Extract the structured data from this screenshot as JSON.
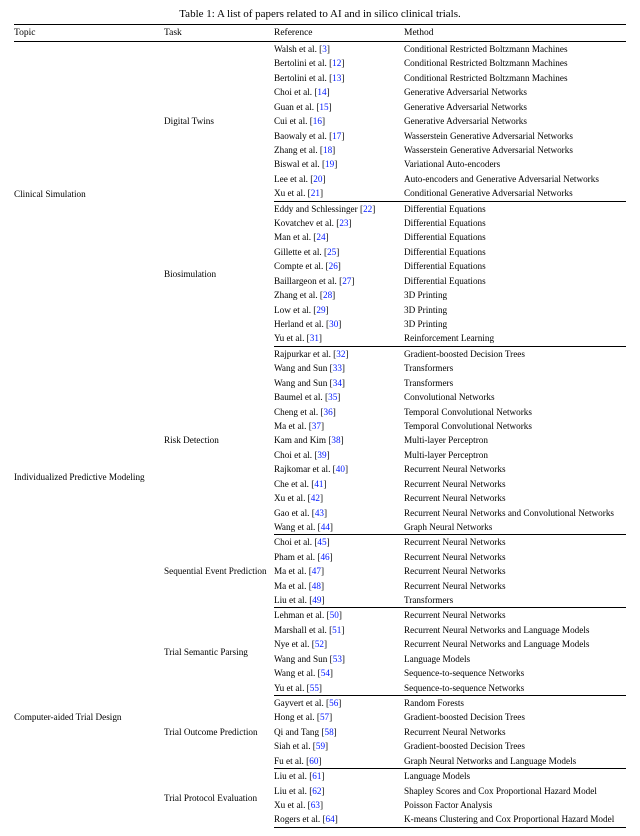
{
  "caption_prefix": "Table 1:",
  "caption_text": "A list of papers related to AI and in silico clinical trials.",
  "headers": [
    "Topic",
    "Task",
    "Reference",
    "Method"
  ],
  "topics": [
    {
      "name": "Clinical Simulation",
      "tasks": [
        {
          "name": "Digital Twins",
          "rows": [
            {
              "ref_text": "Walsh et al.",
              "cite": "3",
              "method": "Conditional Restricted Boltzmann Machines"
            },
            {
              "ref_text": "Bertolini et al.",
              "cite": "12",
              "method": "Conditional Restricted Boltzmann Machines"
            },
            {
              "ref_text": "Bertolini et al.",
              "cite": "13",
              "method": "Conditional Restricted Boltzmann Machines"
            },
            {
              "ref_text": "Choi et al.",
              "cite": "14",
              "method": "Generative Adversarial Networks"
            },
            {
              "ref_text": "Guan et al.",
              "cite": "15",
              "method": "Generative Adversarial Networks"
            },
            {
              "ref_text": "Cui et al.",
              "cite": "16",
              "method": "Generative Adversarial Networks"
            },
            {
              "ref_text": "Baowaly et al.",
              "cite": "17",
              "method": "Wasserstein Generative Adversarial Networks"
            },
            {
              "ref_text": "Zhang et al.",
              "cite": "18",
              "method": "Wasserstein Generative Adversarial Networks"
            },
            {
              "ref_text": "Biswal et al.",
              "cite": "19",
              "method": "Variational Auto-encoders"
            },
            {
              "ref_text": "Lee et al.",
              "cite": "20",
              "method": "Auto-encoders and Generative Adversarial Networks"
            },
            {
              "ref_text": "Xu et al.",
              "cite": "21",
              "method": "Conditional Generative Adversarial Networks"
            }
          ]
        },
        {
          "name": "Biosimulation",
          "rows": [
            {
              "ref_text": "Eddy and Schlessinger",
              "cite": "22",
              "method": "Differential Equations"
            },
            {
              "ref_text": "Kovatchev et al.",
              "cite": "23",
              "method": "Differential Equations"
            },
            {
              "ref_text": "Man et al.",
              "cite": "24",
              "method": "Differential Equations"
            },
            {
              "ref_text": "Gillette et al.",
              "cite": "25",
              "method": "Differential Equations"
            },
            {
              "ref_text": "Compte et al.",
              "cite": "26",
              "method": "Differential Equations"
            },
            {
              "ref_text": "Baillargeon et al.",
              "cite": "27",
              "method": "Differential Equations"
            },
            {
              "ref_text": "Zhang et al.",
              "cite": "28",
              "method": "3D Printing"
            },
            {
              "ref_text": "Low et al.",
              "cite": "29",
              "method": "3D Printing"
            },
            {
              "ref_text": "Herland et al.",
              "cite": "30",
              "method": "3D Printing"
            },
            {
              "ref_text": "Yu et al.",
              "cite": "31",
              "method": "Reinforcement Learning"
            }
          ]
        }
      ]
    },
    {
      "name": "Individualized Predictive Modeling",
      "tasks": [
        {
          "name": "Risk Detection",
          "rows": [
            {
              "ref_text": "Rajpurkar et al.",
              "cite": "32",
              "method": "Gradient-boosted Decision Trees"
            },
            {
              "ref_text": "Wang and Sun",
              "cite": "33",
              "method": "Transformers"
            },
            {
              "ref_text": "Wang and Sun",
              "cite": "34",
              "method": "Transformers"
            },
            {
              "ref_text": "Baumel et al.",
              "cite": "35",
              "method": "Convolutional Networks"
            },
            {
              "ref_text": "Cheng et al.",
              "cite": "36",
              "method": "Temporal Convolutional Networks"
            },
            {
              "ref_text": "Ma et al.",
              "cite": "37",
              "method": "Temporal Convolutional Networks"
            },
            {
              "ref_text": "Kam and Kim",
              "cite": "38",
              "method": "Multi-layer Perceptron"
            },
            {
              "ref_text": "Choi et al.",
              "cite": "39",
              "method": "Multi-layer Perceptron"
            },
            {
              "ref_text": "Rajkomar et al.",
              "cite": "40",
              "method": "Recurrent Neural Networks"
            },
            {
              "ref_text": "Che et al.",
              "cite": "41",
              "method": "Recurrent Neural Networks"
            },
            {
              "ref_text": "Xu et al.",
              "cite": "42",
              "method": "Recurrent Neural Networks"
            },
            {
              "ref_text": "Gao et al.",
              "cite": "43",
              "method": "Recurrent Neural Networks and Convolutional Networks"
            },
            {
              "ref_text": "Wang et al.",
              "cite": "44",
              "method": "Graph Neural Networks"
            }
          ]
        },
        {
          "name": "Sequential Event Prediction",
          "rows": [
            {
              "ref_text": "Choi et al.",
              "cite": "45",
              "method": "Recurrent Neural Networks"
            },
            {
              "ref_text": "Pham et al.",
              "cite": "46",
              "method": "Recurrent Neural Networks"
            },
            {
              "ref_text": "Ma et al.",
              "cite": "47",
              "method": "Recurrent Neural Networks"
            },
            {
              "ref_text": "Ma et al.",
              "cite": "48",
              "method": "Recurrent Neural Networks"
            },
            {
              "ref_text": "Liu et al.",
              "cite": "49",
              "method": "Transformers"
            }
          ]
        }
      ]
    },
    {
      "name": "Computer-aided Trial Design",
      "tasks": [
        {
          "name": "Trial Semantic Parsing",
          "rows": [
            {
              "ref_text": "Lehman et al.",
              "cite": "50",
              "method": "Recurrent Neural Networks"
            },
            {
              "ref_text": "Marshall et al.",
              "cite": "51",
              "method": "Recurrent Neural Networks and Language Models"
            },
            {
              "ref_text": "Nye et al.",
              "cite": "52",
              "method": "Recurrent Neural Networks and Language Models"
            },
            {
              "ref_text": "Wang and Sun",
              "cite": "53",
              "method": "Language Models"
            },
            {
              "ref_text": "Wang et al.",
              "cite": "54",
              "method": "Sequence-to-sequence Networks"
            },
            {
              "ref_text": "Yu et al.",
              "cite": "55",
              "method": "Sequence-to-sequence Networks"
            }
          ]
        },
        {
          "name": "Trial Outcome Prediction",
          "rows": [
            {
              "ref_text": "Gayvert et al.",
              "cite": "56",
              "method": "Random Forests"
            },
            {
              "ref_text": "Hong et al.",
              "cite": "57",
              "method": "Gradient-boosted Decision Trees"
            },
            {
              "ref_text": "Qi and Tang",
              "cite": "58",
              "method": "Recurrent Neural Networks"
            },
            {
              "ref_text": "Siah et al.",
              "cite": "59",
              "method": "Gradient-boosted Decision Trees"
            },
            {
              "ref_text": "Fu et al.",
              "cite": "60",
              "method": "Graph Neural Networks and Language Models"
            }
          ]
        },
        {
          "name": "Trial Protocol Evaluation",
          "rows": [
            {
              "ref_text": "Liu et al.",
              "cite": "61",
              "method": "Language Models"
            },
            {
              "ref_text": "Liu et al.",
              "cite": "62",
              "method": "Shapley Scores and Cox Proportional Hazard Model"
            },
            {
              "ref_text": "Xu et al.",
              "cite": "63",
              "method": "Poisson Factor Analysis"
            },
            {
              "ref_text": "Rogers et al.",
              "cite": "64",
              "method": "K-means Clustering and Cox Proportional Hazard Model"
            }
          ]
        }
      ]
    }
  ]
}
